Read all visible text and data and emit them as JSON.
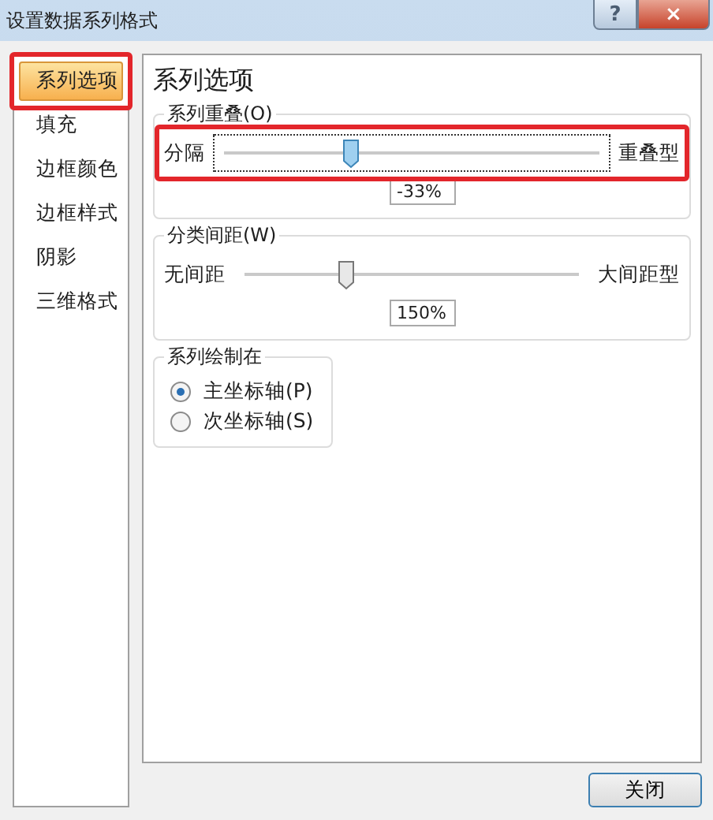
{
  "window": {
    "title": "设置数据系列格式",
    "help_button": "?",
    "close_button": "×"
  },
  "sidebar": {
    "items": [
      {
        "label": "系列选项",
        "selected": true,
        "highlighted": true
      },
      {
        "label": "填充",
        "selected": false,
        "highlighted": false
      },
      {
        "label": "边框颜色",
        "selected": false,
        "highlighted": false
      },
      {
        "label": "边框样式",
        "selected": false,
        "highlighted": false
      },
      {
        "label": "阴影",
        "selected": false,
        "highlighted": false
      },
      {
        "label": "三维格式",
        "selected": false,
        "highlighted": false
      }
    ]
  },
  "panel": {
    "heading": "系列选项",
    "sliders": [
      {
        "group": "系列重叠(O)",
        "left_label": "分隔",
        "right_label": "重叠型",
        "level": 0.335,
        "value": "-33%",
        "focused": true,
        "highlighted": true
      },
      {
        "group": "分类间距(W)",
        "left_label": "无间距",
        "right_label": "大间距型",
        "level": 0.3,
        "value": "150%",
        "focused": false,
        "highlighted": false
      }
    ],
    "plot_on": {
      "group": "系列绘制在",
      "options": [
        {
          "label": "主坐标轴(P)",
          "selected": true
        },
        {
          "label": "次坐标轴(S)",
          "selected": false
        }
      ]
    }
  },
  "buttons": [
    {
      "label": "关闭"
    }
  ]
}
